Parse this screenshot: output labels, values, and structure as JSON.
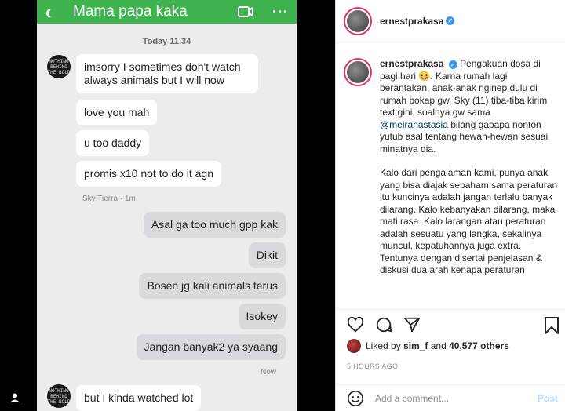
{
  "chat": {
    "title": "Mama papa kaka",
    "back_icon": "chevron-left-icon",
    "date_separator": "Today 11.34",
    "avatar_text": "NOTHING BEHIND THE BOLD",
    "messages": [
      {
        "dir": "in",
        "text": "imsorry I sometimes don't watch always animals but I will now"
      },
      {
        "dir": "in",
        "text": "love you mah"
      },
      {
        "dir": "in",
        "text": "u too daddy"
      },
      {
        "dir": "in",
        "text": "promis x10 not to do it agn"
      },
      {
        "dir": "out",
        "text": "Asal ga too much gpp kak"
      },
      {
        "dir": "out",
        "text": "Dikit"
      },
      {
        "dir": "out",
        "text": "Bosen jg kali animals terus"
      },
      {
        "dir": "out",
        "text": "Isokey"
      },
      {
        "dir": "out",
        "text": "Jangan banyak2 ya syaang"
      },
      {
        "dir": "in",
        "text": "but I kinda watched lot"
      }
    ],
    "sender_meta": "Sky Tierra · 1m",
    "out_meta": "Now"
  },
  "post": {
    "username": "ernestprakasa",
    "caption_intro": "Pengakuan dosa di pagi hari 😆. Karna rumah lagi berantakan, anak-anak nginep dulu di rumah bokap gw. Sky (11) tiba-tiba kirim text gini, soalnya gw sama",
    "mention": "@meiranastasia",
    "caption_rest": "bilang gapapa nonton yutub asal tentang hewan-hewan sesuai minatnya dia.",
    "paragraph2": "Kalo dari pengalaman kami, punya anak yang bisa diajak sepaham sama peraturan itu kuncinya adalah jangan terlalu banyak dilarang. Kalo kebanyakan dilarang, maka mati rasa. Kalo larangan atau peraturan adalah sesuatu yang langka, sekalinya muncul, kepatuhannya juga extra. Tentunya dengan disertai penjelasan & diskusi dua arah kenapa peraturan",
    "likes_prefix": "Liked by",
    "likes_user": "sim_f",
    "likes_and": "and",
    "likes_count": "40,577 others",
    "time": "5 HOURS AGO",
    "comment_placeholder": "Add a comment...",
    "post_button": "Post"
  },
  "colors": {
    "chat_header": "#3fb34f",
    "verified": "#3897f0",
    "mention": "#00376b"
  }
}
